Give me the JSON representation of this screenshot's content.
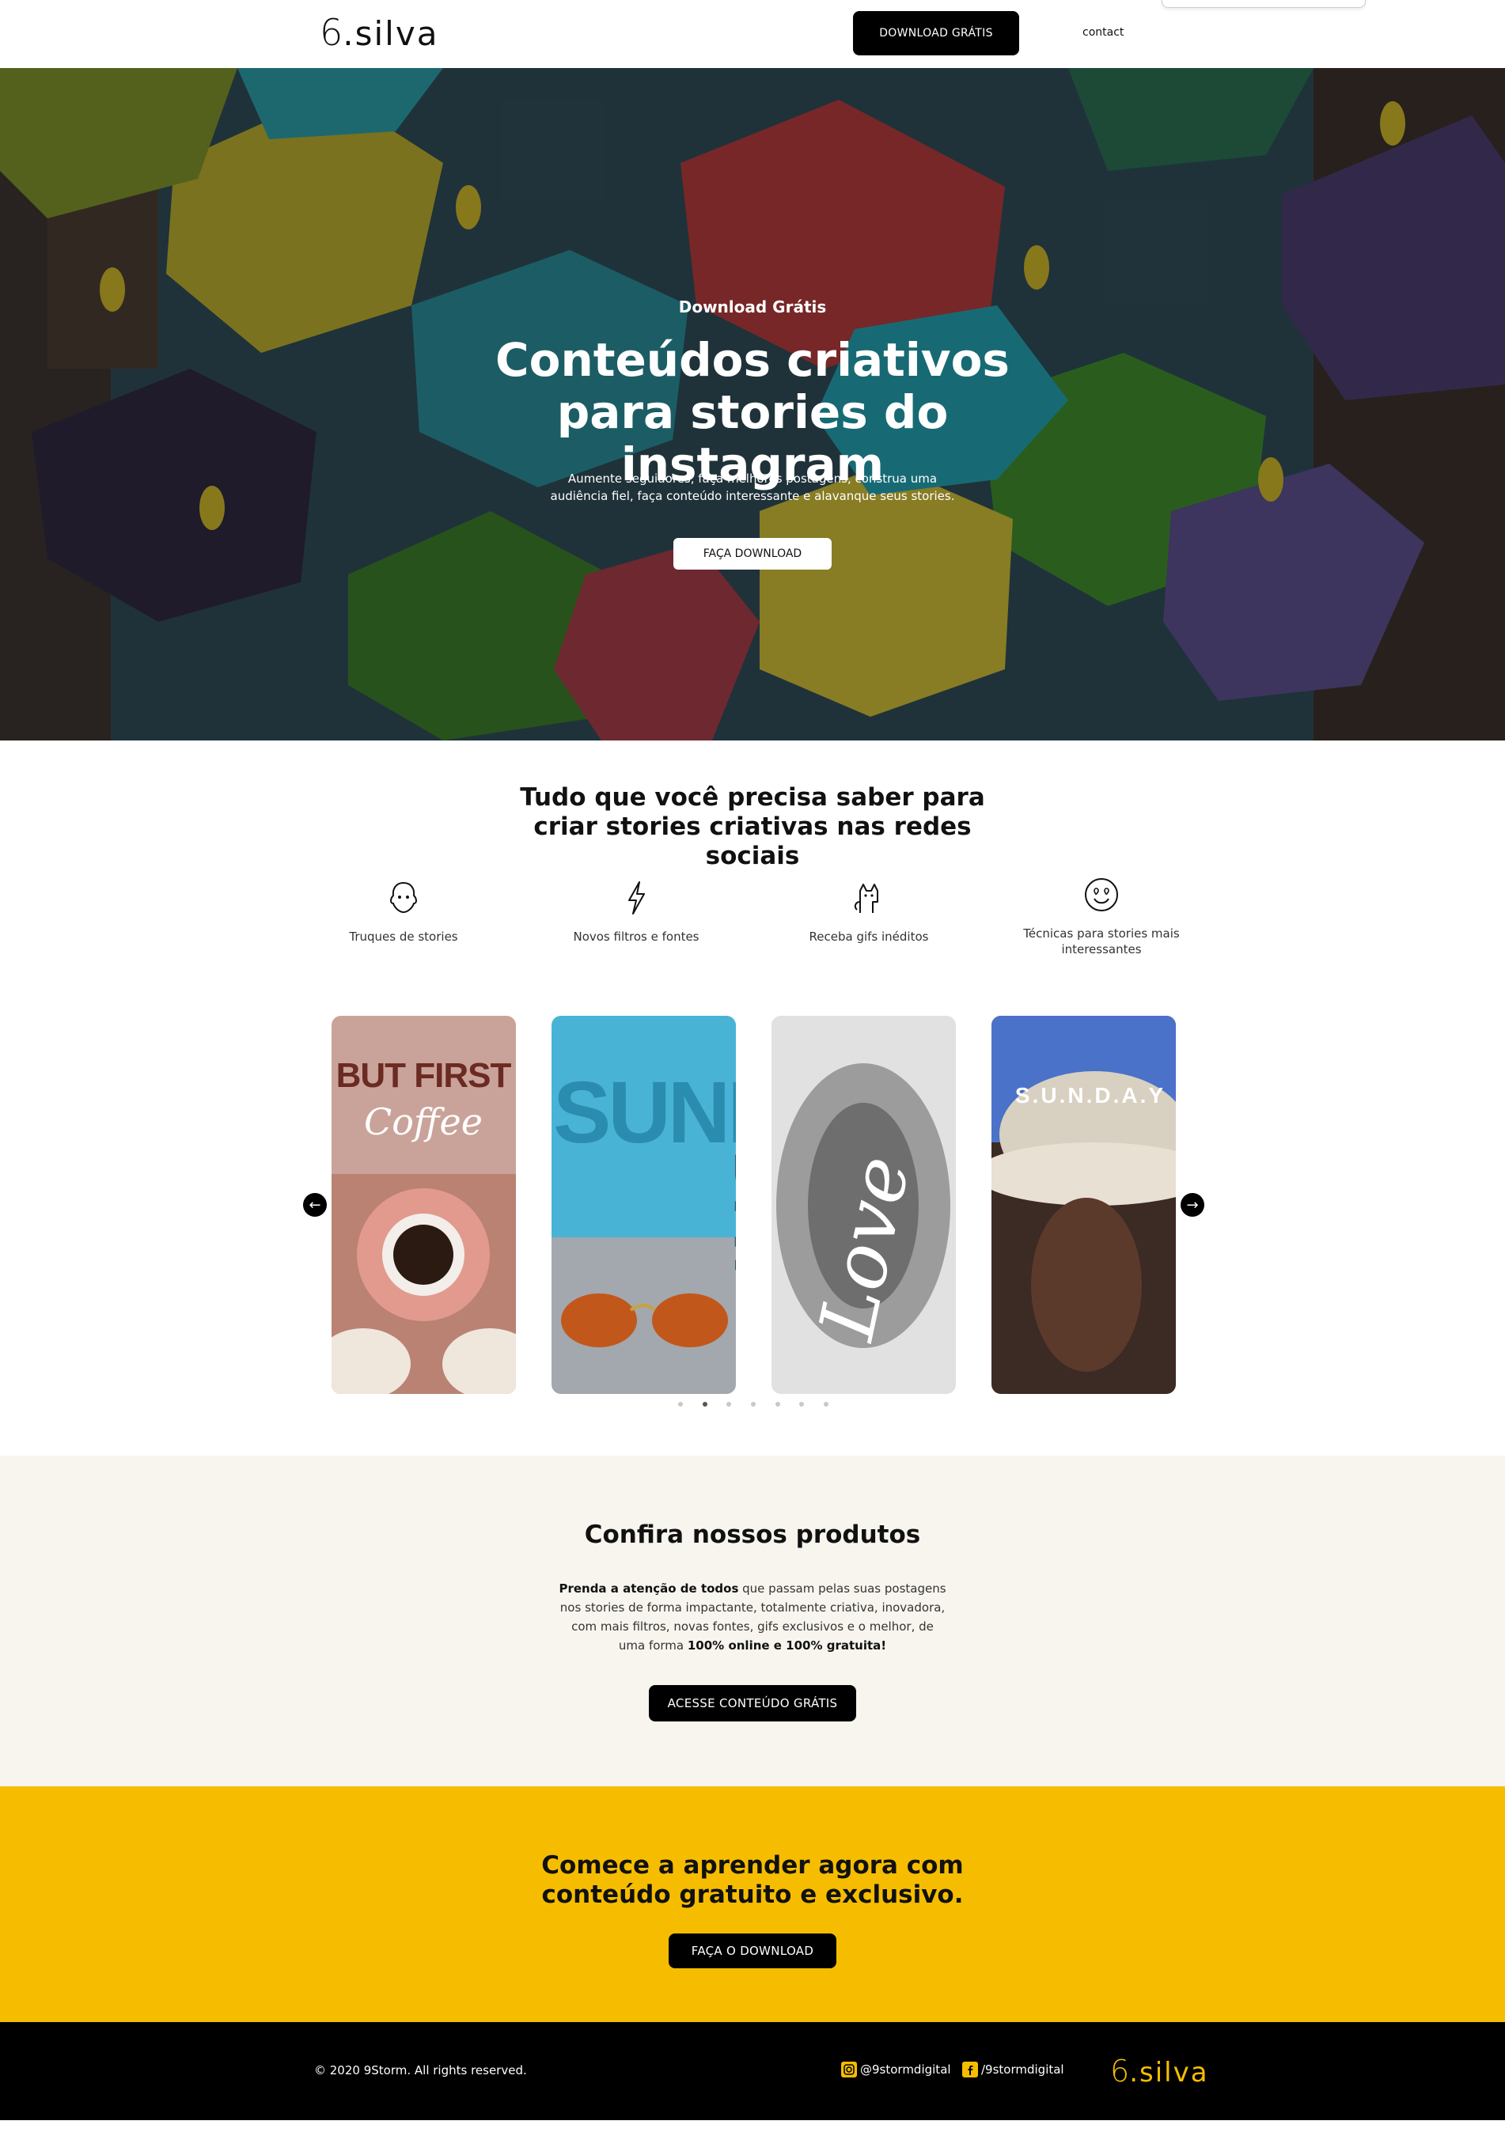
{
  "header": {
    "logo": {
      "mark": "6",
      "text": ".silva"
    },
    "download_button": "DOWNLOAD GRÁTIS",
    "contact_link": "contact"
  },
  "hero": {
    "kicker": "Download Grátis",
    "title": "Conteúdos criativos para stories do instagram",
    "subtitle": "Aumente seguidores, faça melhores postagens, construa uma audiência fiel, faça conteúdo interessante e alavanque seus stories.",
    "button": "FAÇA DOWNLOAD"
  },
  "features": {
    "title": "Tudo que você precisa saber para criar stories criativas nas redes sociais",
    "items": [
      {
        "icon": "ghost-icon",
        "label": "Truques de stories"
      },
      {
        "icon": "lightning-icon",
        "label": "Novos filtros e fontes"
      },
      {
        "icon": "cat-icon",
        "label": "Receba gifs inéditos"
      },
      {
        "icon": "smile-hearts-icon",
        "label": "Técnicas para stories mais interessantes"
      }
    ]
  },
  "carousel": {
    "cards": [
      {
        "line1": "BUT FIRST",
        "line2": "Coffee"
      },
      {
        "line1": "SUNNY",
        "line2": "DAY"
      },
      {
        "line1": "Love"
      },
      {
        "line1": "S.U.N.D.A.Y"
      }
    ],
    "prev_icon": "arrow-left-icon",
    "next_icon": "arrow-right-icon",
    "active_dot": 1,
    "dot_count": 7
  },
  "products": {
    "title": "Confira nossos produtos",
    "text_bold_1": "Prenda a atenção de todos",
    "text_1": " que passam pelas suas postagens nos stories de forma impactante, totalmente criativa, inovadora, com mais filtros, novas fontes, gifs exclusivos e o melhor, de uma forma ",
    "text_bold_2": "100% online e 100% gratuita!",
    "button": "ACESSE CONTEÚDO GRÁTIS"
  },
  "cta": {
    "title": "Comece a aprender agora com conteúdo gratuito e exclusivo.",
    "button": "FAÇA O DOWNLOAD"
  },
  "footer": {
    "copyright": "© 2020 9Storm. All rights reserved.",
    "instagram": "@9stormdigital",
    "facebook": "/9stormdigital",
    "logo": {
      "mark": "6",
      "text": ".silva"
    }
  },
  "colors": {
    "accent_yellow": "#f6bd00",
    "dark": "#000000",
    "products_bg": "#f7f5ee"
  }
}
